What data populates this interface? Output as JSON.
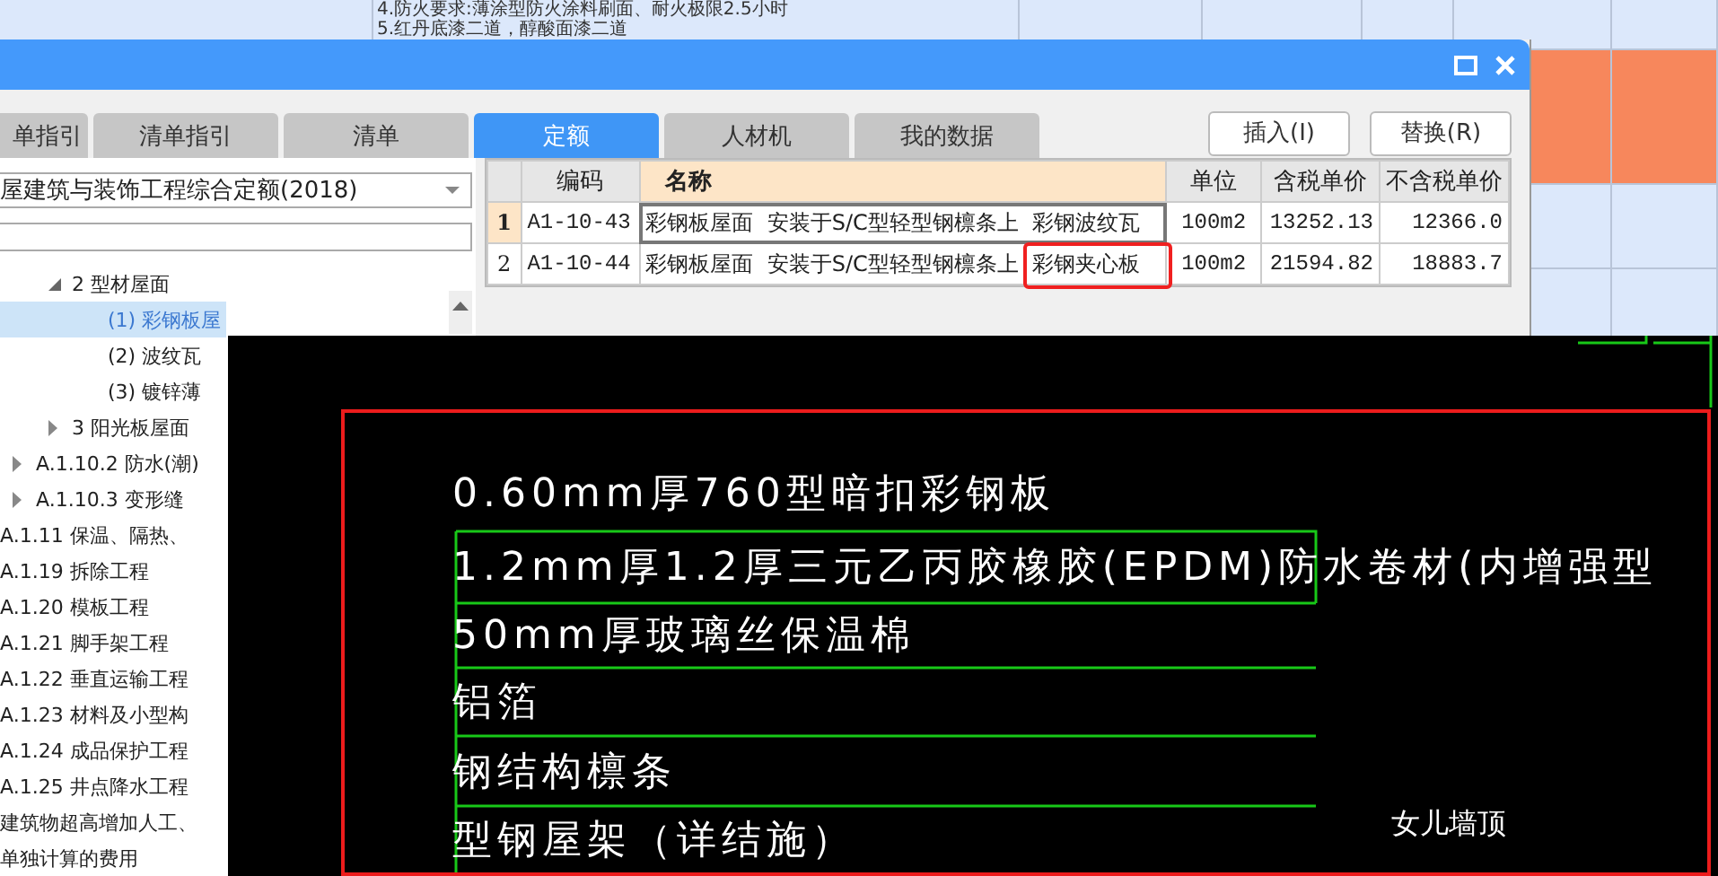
{
  "background_sheet": {
    "note_lines": [
      "4.防火要求:薄涂型防火涂料刷面、耐火极限2.5小时",
      "5.红丹底漆二道，醇酸面漆二道"
    ]
  },
  "dialog": {
    "tabs": [
      {
        "label": "单指引",
        "selected": false
      },
      {
        "label": "清单指引",
        "selected": false
      },
      {
        "label": "清单",
        "selected": false
      },
      {
        "label": "定额",
        "selected": true
      },
      {
        "label": "人材机",
        "selected": false
      },
      {
        "label": "我的数据",
        "selected": false
      }
    ],
    "buttons": [
      "插入(I)",
      "替换(R)"
    ],
    "library": "屋建筑与装饰工程综合定额(2018)",
    "tree": [
      {
        "children": [
          {
            "children": [
              {
                "label": "2 型材屋面",
                "expanded": true,
                "children": [
                  {
                    "label": "(1) 彩钢板屋",
                    "selected": true
                  },
                  {
                    "label": "(2) 波纹瓦",
                    "selected": false
                  },
                  {
                    "label": "(3) 镀锌薄",
                    "selected": false
                  }
                ]
              },
              {
                "label": "3 阳光板屋面",
                "expanded": false
              }
            ]
          },
          {
            "label": "A.1.10.2 防水(潮)",
            "expanded": false
          },
          {
            "label": "A.1.10.3 变形缝",
            "expanded": false
          }
        ]
      },
      {
        "label": "A.1.11 保温、隔热、",
        "selected": false
      },
      {
        "label": "A.1.19 拆除工程",
        "selected": false
      },
      {
        "label": "A.1.20 模板工程",
        "selected": false
      },
      {
        "label": "A.1.21 脚手架工程",
        "selected": false
      },
      {
        "label": "A.1.22 垂直运输工程",
        "selected": false
      },
      {
        "label": "A.1.23 材料及小型构",
        "selected": false
      },
      {
        "label": "A.1.24 成品保护工程",
        "selected": false
      },
      {
        "label": "A.1.25 井点降水工程",
        "selected": false
      },
      {
        "label": "建筑物超高增加人工、",
        "selected": false
      },
      {
        "label": "单独计算的费用",
        "selected": false
      }
    ],
    "table": {
      "columns": [
        {
          "label": "编码",
          "selected": false
        },
        {
          "label": "名称",
          "selected": true
        },
        {
          "label": "单位",
          "selected": false
        },
        {
          "label": "含税单价",
          "selected": false
        },
        {
          "label": "不含税单价",
          "selected": false
        }
      ],
      "rows": [
        {
          "number": "1",
          "code": "A1-10-43",
          "name": "彩钢板屋面 安装于S/C型轻型钢檩条上 彩钢波纹瓦",
          "unit": "100m2",
          "price_with_tax": "13252.13",
          "price_without_tax": "12366.0",
          "selected": true,
          "annotated": false
        },
        {
          "number": "2",
          "code": "A1-10-44",
          "name": "彩钢板屋面 安装于S/C型轻型钢檩条上 彩钢夹心板",
          "unit": "100m2",
          "price_with_tax": "21594.82",
          "price_without_tax": "18883.7",
          "selected": false,
          "annotated": true
        }
      ]
    }
  },
  "cad_drawing": {
    "layers": [
      "0.60mm厚760型暗扣彩钢板",
      "1.2mm厚1.2厚三元乙丙胶橡胶(EPDM)防水卷材(内增强型",
      "50mm厚玻璃丝保温棉",
      "铝箔",
      "钢结构檩条",
      "型钢屋架（详结施）"
    ],
    "note": "女儿墙顶"
  }
}
